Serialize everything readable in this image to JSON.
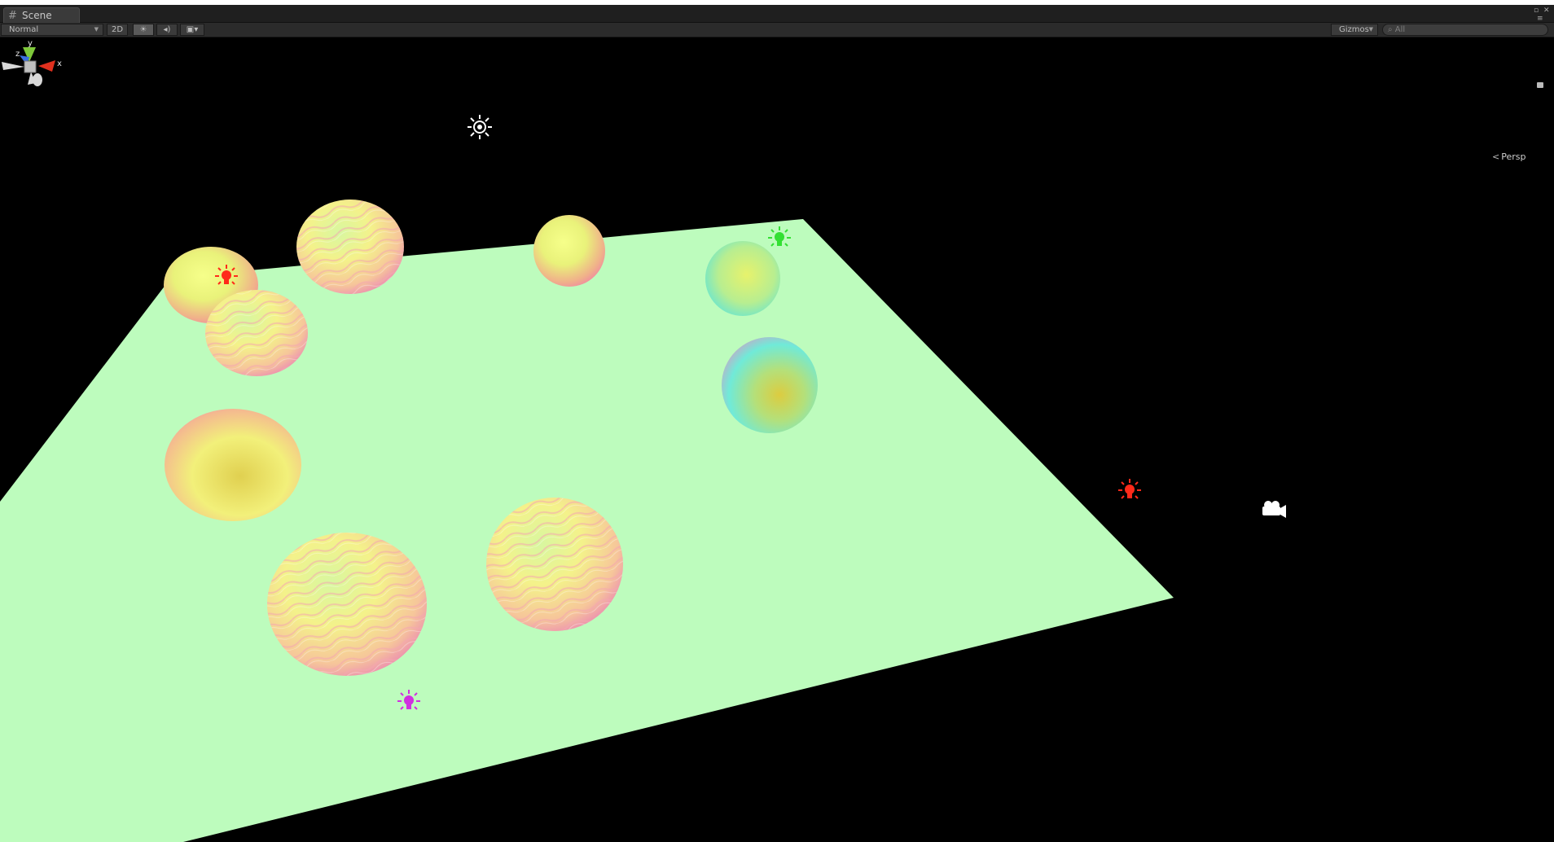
{
  "window": {
    "tab_label": "Scene"
  },
  "toolbar": {
    "draw_mode": "Normal",
    "btn_2d": "2D",
    "lighting_icon": "sun-icon",
    "audio_icon": "speaker-icon",
    "effects_icon": "image-icon",
    "gizmos_label": "Gizmos",
    "search_placeholder": "All"
  },
  "scene_gizmo": {
    "axis_y": "y",
    "axis_z": "z",
    "axis_x": "x",
    "projection_label": "Persp"
  },
  "scene": {
    "plane_color": "#bdfcbd",
    "lights": [
      {
        "type": "directional",
        "color": "#ffffff"
      },
      {
        "type": "point",
        "color": "#ff2a1a"
      },
      {
        "type": "point",
        "color": "#33e033"
      },
      {
        "type": "point",
        "color": "#ff2a1a"
      },
      {
        "type": "point",
        "color": "#d030e0"
      }
    ],
    "camera_icon": "camera-icon"
  },
  "colors": {
    "bg": "#000000",
    "tabbar": "#1f1f1f",
    "toolbar": "#2b2b2b",
    "axis_x": "#e0301e",
    "axis_y": "#7ec83a",
    "axis_z": "#3a6fe0"
  }
}
